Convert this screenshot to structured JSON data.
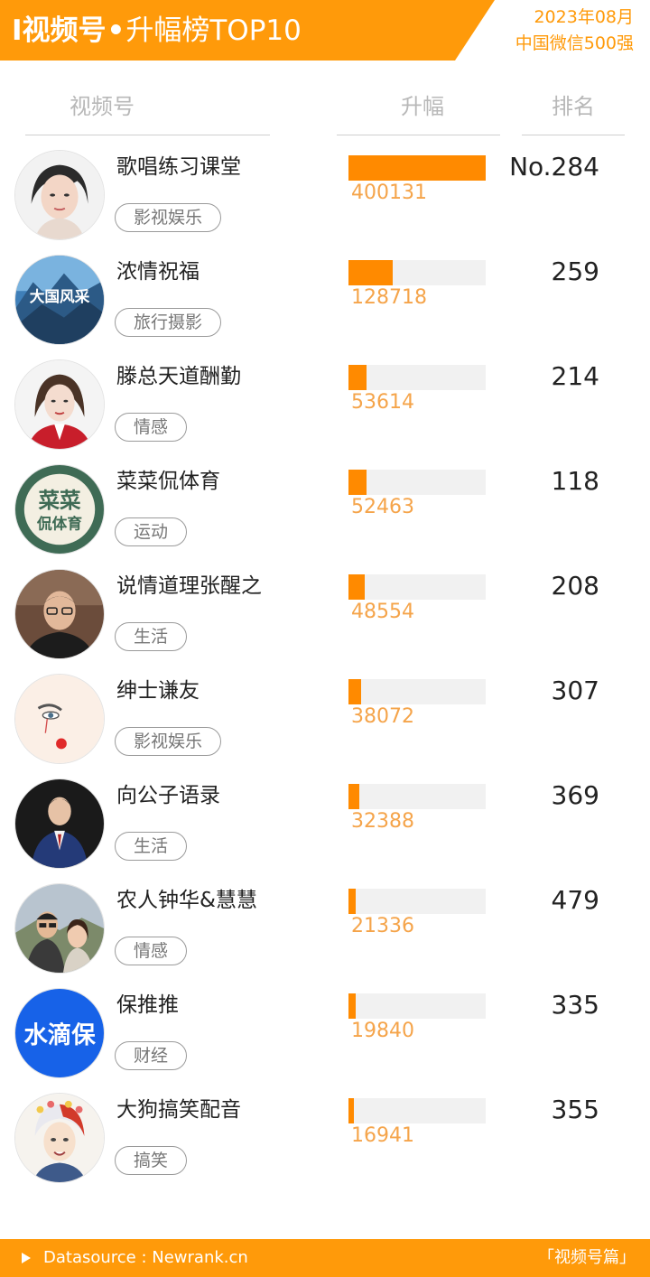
{
  "header": {
    "title_bold": "I视频号",
    "title_dot": "•",
    "title_rest": "升幅榜TOP10",
    "date": "2023年08月",
    "subtitle": "中国微信500强",
    "accent_color": "#ff9a0a"
  },
  "columns": {
    "channel": "视频号",
    "growth": "升幅",
    "rank": "排名"
  },
  "chart_data": {
    "type": "bar",
    "orientation": "horizontal",
    "title": "升幅榜TOP10",
    "categories": [
      "歌唱练习课堂",
      "浓情祝福",
      "滕总天道酬勤",
      "菜菜侃体育",
      "说情道理张醒之",
      "绅士谦友",
      "向公子语录",
      "农人钟华&慧慧",
      "保推推",
      "大狗搞笑配音"
    ],
    "values": [
      400131,
      128718,
      53614,
      52463,
      48554,
      38072,
      32388,
      21336,
      19840,
      16941
    ],
    "bar_color": "#ff8a00",
    "track_color": "#f1f1f1",
    "xlim": [
      0,
      400131
    ]
  },
  "rows": [
    {
      "name": "歌唱练习课堂",
      "tag": "影视娱乐",
      "value": "400131",
      "rank": "No.284",
      "avatar_icon": "woman-portrait-icon"
    },
    {
      "name": "浓情祝福",
      "tag": "旅行摄影",
      "value": "128718",
      "rank": "259",
      "avatar_icon": "mountain-landscape-icon",
      "avatar_text": "大国风采"
    },
    {
      "name": "滕总天道酬勤",
      "tag": "情感",
      "value": "53614",
      "rank": "214",
      "avatar_icon": "woman-red-jacket-icon"
    },
    {
      "name": "菜菜侃体育",
      "tag": "运动",
      "value": "52463",
      "rank": "118",
      "avatar_icon": "text-logo-icon",
      "avatar_text_1": "菜菜",
      "avatar_text_2": "侃体育"
    },
    {
      "name": "说情道理张醒之",
      "tag": "生活",
      "value": "48554",
      "rank": "208",
      "avatar_icon": "man-glasses-icon"
    },
    {
      "name": "绅士谦友",
      "tag": "影视娱乐",
      "value": "38072",
      "rank": "307",
      "avatar_icon": "painted-face-icon"
    },
    {
      "name": "向公子语录",
      "tag": "生活",
      "value": "32388",
      "rank": "369",
      "avatar_icon": "man-suit-icon"
    },
    {
      "name": "农人钟华&慧慧",
      "tag": "情感",
      "value": "21336",
      "rank": "479",
      "avatar_icon": "couple-photo-icon"
    },
    {
      "name": "保推推",
      "tag": "财经",
      "value": "19840",
      "rank": "335",
      "avatar_icon": "blue-logo-icon",
      "avatar_text": "水滴保"
    },
    {
      "name": "大狗搞笑配音",
      "tag": "搞笑",
      "value": "16941",
      "rank": "355",
      "avatar_icon": "anime-character-icon"
    }
  ],
  "footer": {
    "source": "Datasource : Newrank.cn",
    "label": "「视频号篇」"
  }
}
